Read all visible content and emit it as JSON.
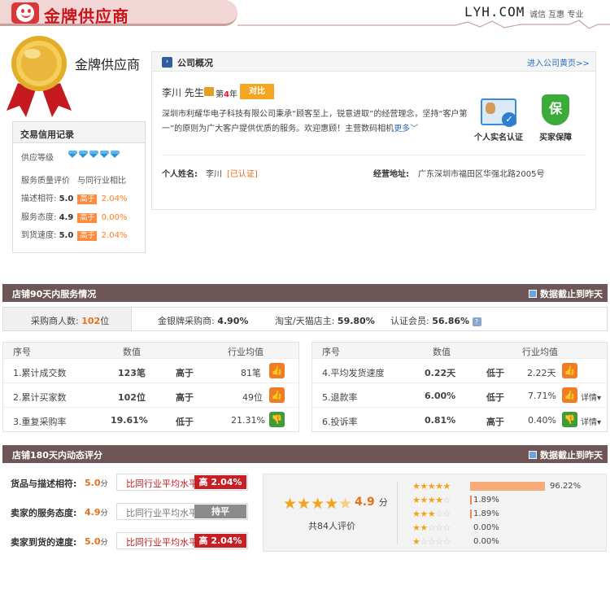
{
  "header": {
    "gold_title": "金牌供应商",
    "brand": "LYH.COM",
    "brand_tagline": "诚信 互惠 专业"
  },
  "medal": {
    "label": "金牌供应商"
  },
  "credit": {
    "title": "交易信用记录",
    "supply_level_label": "供应等级",
    "diamond_count": 5,
    "service_eval_label": "服务质量评价",
    "industry_compare_label": "与同行业相比",
    "rows": [
      {
        "label": "描述相符:",
        "score": "5.0",
        "tag": "高于",
        "pct": "2.04%"
      },
      {
        "label": "服务态度:",
        "score": "4.9",
        "tag": "高于",
        "pct": "0.00%"
      },
      {
        "label": "到货速度:",
        "score": "5.0",
        "tag": "高于",
        "pct": "2.04%"
      }
    ]
  },
  "company": {
    "title": "公司概况",
    "link": "进入公司黄页>>",
    "person": "李川 先生",
    "year_prefix": "第",
    "year_num": "4",
    "year_suffix": "年",
    "compare_button": "对比",
    "description": "深圳市利耀华电子科技有限公司秉承“顾客至上，锐意进取”的经营理念，坚持“客户第一”的原则为广大客户提供优质的服务。欢迎惠顾！主营数码相机",
    "more_link": "更多",
    "badge_identity": "个人实名认证",
    "badge_guarantee": "买家保障",
    "guarantee_glyph": "保",
    "name_label": "个人姓名:",
    "name_value": "李川",
    "verified": "[已认证]",
    "address_label": "经营地址:",
    "address_value": "广东深圳市福田区华强北路2005号"
  },
  "service90": {
    "title": "店铺90天内服务情况",
    "cutoff": "数据截止到昨天",
    "buyers_label": "采购商人数:",
    "buyers_value": "102",
    "buyers_unit": "位",
    "gold_silver_label": "金银牌采购商:",
    "gold_silver_value": "4.90%",
    "taobao_label": "淘宝/天猫店主:",
    "taobao_value": "59.80%",
    "certified_label": "认证会员:",
    "certified_value": "56.86%",
    "help_glyph": "?",
    "col_no": "序号",
    "col_value": "数值",
    "col_avg": "行业均值",
    "left_rows": [
      {
        "name": "1.累计成交数",
        "value": "123笔",
        "cmp": "高于",
        "avg": "81笔",
        "thumb": "up"
      },
      {
        "name": "2.累计买家数",
        "value": "102位",
        "cmp": "高于",
        "avg": "49位",
        "thumb": "up"
      },
      {
        "name": "3.重复采购率",
        "value": "19.61%",
        "cmp": "低于",
        "avg": "21.31%",
        "thumb": "down"
      }
    ],
    "right_rows": [
      {
        "name": "4.平均发货速度",
        "value": "0.22天",
        "cmp": "低于",
        "avg": "2.22天",
        "thumb": "up",
        "detail": ""
      },
      {
        "name": "5.退款率",
        "value": "6.00%",
        "cmp": "低于",
        "avg": "7.71%",
        "thumb": "up",
        "detail": "详情"
      },
      {
        "name": "6.投诉率",
        "value": "0.81%",
        "cmp": "高于",
        "avg": "0.40%",
        "thumb": "down",
        "detail": "详情"
      }
    ]
  },
  "rating180": {
    "title": "店铺180天内动态评分",
    "cutoff": "数据截止到昨天",
    "unit": "分",
    "rows": [
      {
        "label": "货品与描述相符:",
        "score": "5.0",
        "compare": "比同行业平均水平",
        "badge": "高 2.04%",
        "style": "red"
      },
      {
        "label": "卖家的服务态度:",
        "score": "4.9",
        "compare": "比同行业平均水平",
        "badge": "持平",
        "style": "gray"
      },
      {
        "label": "卖家到货的速度:",
        "score": "5.0",
        "compare": "比同行业平均水平",
        "badge": "高 2.04%",
        "style": "red"
      }
    ],
    "overall_score": "4.9",
    "overall_stars": 4.5,
    "review_count": "共84人评价",
    "distribution": [
      {
        "stars": 5,
        "pct": "96.22%",
        "fraction": 0.9622
      },
      {
        "stars": 4,
        "pct": "1.89%",
        "fraction": 0.0189
      },
      {
        "stars": 3,
        "pct": "1.89%",
        "fraction": 0.0189
      },
      {
        "stars": 2,
        "pct": "0.00%",
        "fraction": 0
      },
      {
        "stars": 1,
        "pct": "0.00%",
        "fraction": 0
      }
    ]
  },
  "colors": {
    "accent_red": "#c8141a",
    "section_bar": "#6d5655",
    "orange": "#e8701a",
    "thumb_up": "#f07c26",
    "thumb_down": "#3e9c39"
  }
}
